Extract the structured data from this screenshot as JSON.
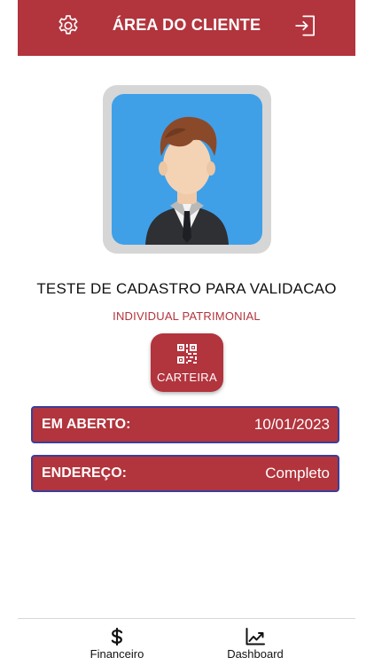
{
  "header": {
    "title": "ÁREA DO CLIENTE",
    "settings_icon": "gear-icon",
    "logout_icon": "logout-icon"
  },
  "profile": {
    "avatar_icon": "user-avatar-icon",
    "name": "TESTE DE CADASTRO PARA VALIDACAO",
    "plan": "INDIVIDUAL PATRIMONIAL"
  },
  "card_button": {
    "label": "CARTEIRA",
    "icon": "qr-code-icon"
  },
  "info": [
    {
      "label": "EM ABERTO:",
      "value": "10/01/2023"
    },
    {
      "label": "ENDEREÇO:",
      "value": "Completo"
    }
  ],
  "tabs": [
    {
      "label": "Financeiro",
      "icon": "dollar-icon"
    },
    {
      "label": "Dashboard",
      "icon": "trending-chart-icon"
    }
  ],
  "colors": {
    "brand": "#b2343d",
    "row_border": "#3a3f9a",
    "avatar_bg": "#3fa0e8"
  }
}
